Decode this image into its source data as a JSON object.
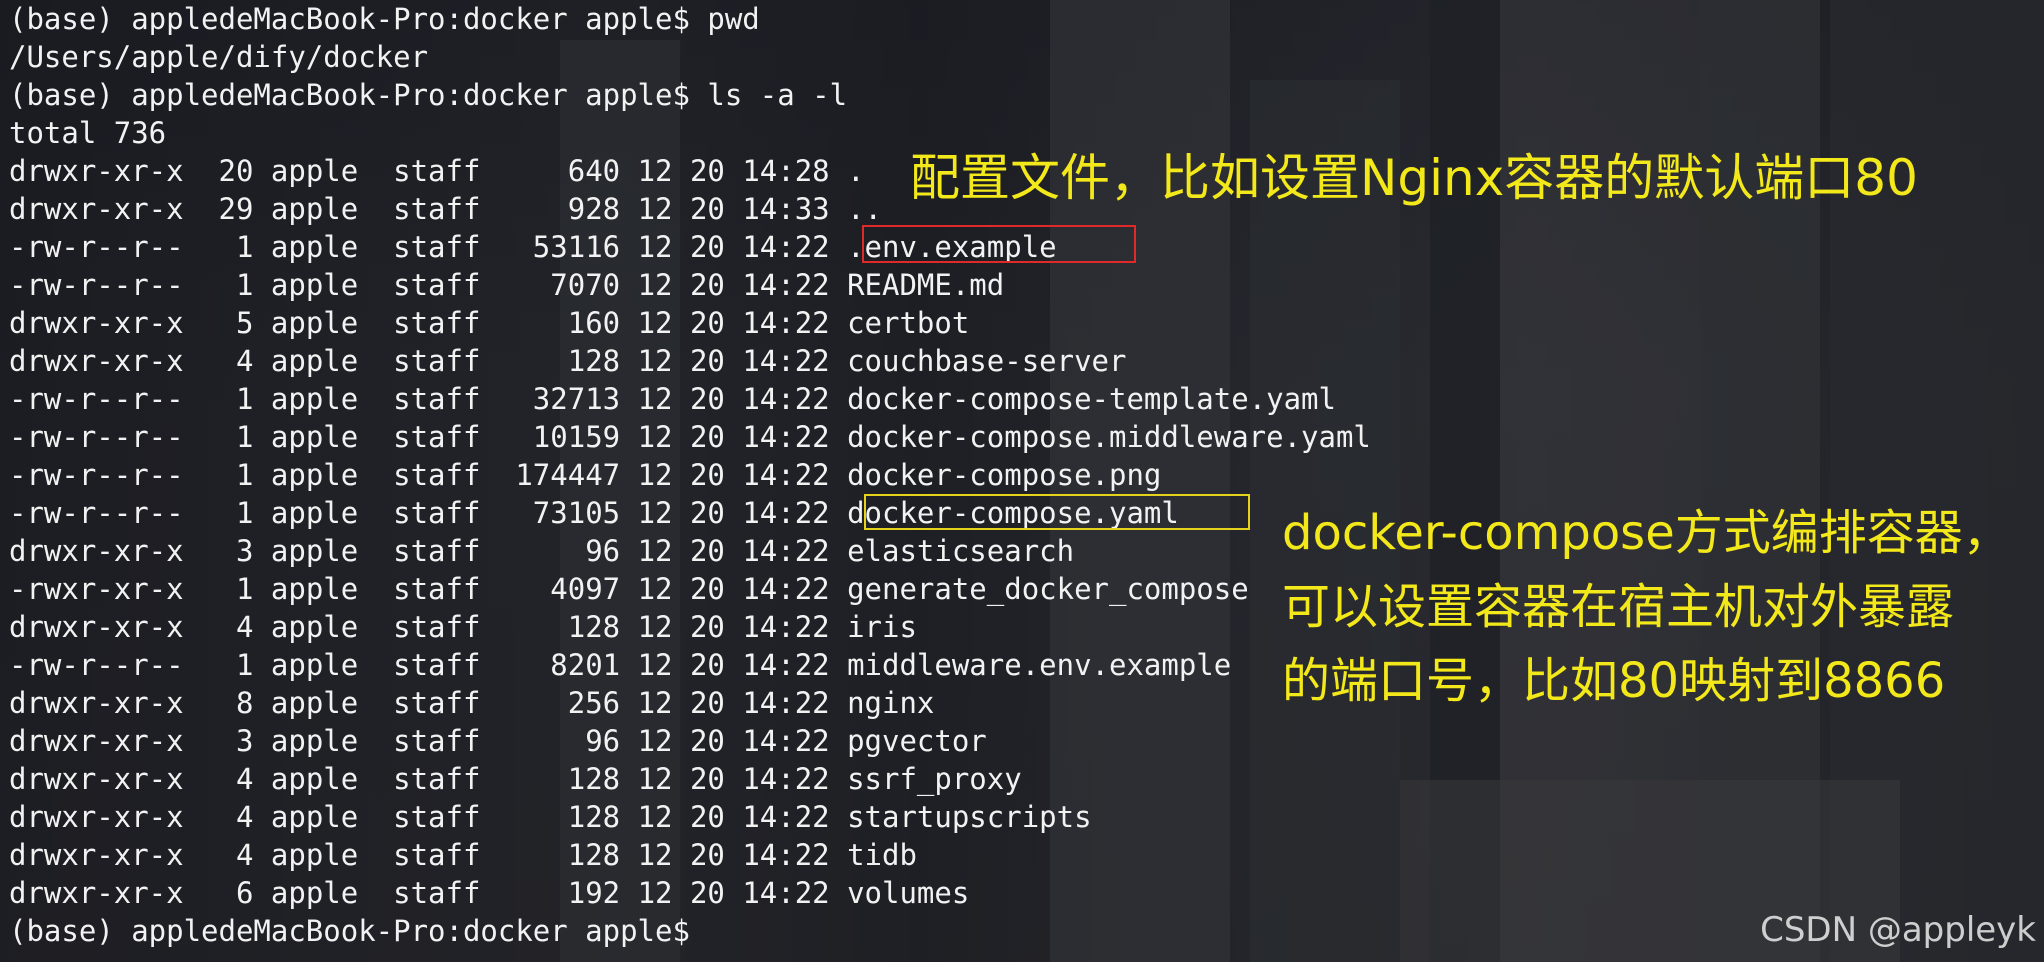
{
  "terminal": {
    "cmd1": "(base) appledeMacBook-Pro:docker apple$ pwd",
    "cmd1_output": "/Users/apple/dify/docker",
    "cmd2": "(base) appledeMacBook-Pro:docker apple$ ls -a -l",
    "total": "total 736",
    "prompt_final": "(base) appledeMacBook-Pro:docker apple$",
    "listing": [
      {
        "perm": "drwxr-xr-x",
        "links": "20",
        "owner": "apple",
        "group": "staff",
        "size": "640",
        "date": "12 20 14:28",
        "name": "."
      },
      {
        "perm": "drwxr-xr-x",
        "links": "29",
        "owner": "apple",
        "group": "staff",
        "size": "928",
        "date": "12 20 14:33",
        "name": ".."
      },
      {
        "perm": "-rw-r--r--",
        "links": "1",
        "owner": "apple",
        "group": "staff",
        "size": "53116",
        "date": "12 20 14:22",
        "name": ".env.example"
      },
      {
        "perm": "-rw-r--r--",
        "links": "1",
        "owner": "apple",
        "group": "staff",
        "size": "7070",
        "date": "12 20 14:22",
        "name": "README.md"
      },
      {
        "perm": "drwxr-xr-x",
        "links": "5",
        "owner": "apple",
        "group": "staff",
        "size": "160",
        "date": "12 20 14:22",
        "name": "certbot"
      },
      {
        "perm": "drwxr-xr-x",
        "links": "4",
        "owner": "apple",
        "group": "staff",
        "size": "128",
        "date": "12 20 14:22",
        "name": "couchbase-server"
      },
      {
        "perm": "-rw-r--r--",
        "links": "1",
        "owner": "apple",
        "group": "staff",
        "size": "32713",
        "date": "12 20 14:22",
        "name": "docker-compose-template.yaml"
      },
      {
        "perm": "-rw-r--r--",
        "links": "1",
        "owner": "apple",
        "group": "staff",
        "size": "10159",
        "date": "12 20 14:22",
        "name": "docker-compose.middleware.yaml"
      },
      {
        "perm": "-rw-r--r--",
        "links": "1",
        "owner": "apple",
        "group": "staff",
        "size": "174447",
        "date": "12 20 14:22",
        "name": "docker-compose.png"
      },
      {
        "perm": "-rw-r--r--",
        "links": "1",
        "owner": "apple",
        "group": "staff",
        "size": "73105",
        "date": "12 20 14:22",
        "name": "docker-compose.yaml"
      },
      {
        "perm": "drwxr-xr-x",
        "links": "3",
        "owner": "apple",
        "group": "staff",
        "size": "96",
        "date": "12 20 14:22",
        "name": "elasticsearch"
      },
      {
        "perm": "-rwxr-xr-x",
        "links": "1",
        "owner": "apple",
        "group": "staff",
        "size": "4097",
        "date": "12 20 14:22",
        "name": "generate_docker_compose"
      },
      {
        "perm": "drwxr-xr-x",
        "links": "4",
        "owner": "apple",
        "group": "staff",
        "size": "128",
        "date": "12 20 14:22",
        "name": "iris"
      },
      {
        "perm": "-rw-r--r--",
        "links": "1",
        "owner": "apple",
        "group": "staff",
        "size": "8201",
        "date": "12 20 14:22",
        "name": "middleware.env.example"
      },
      {
        "perm": "drwxr-xr-x",
        "links": "8",
        "owner": "apple",
        "group": "staff",
        "size": "256",
        "date": "12 20 14:22",
        "name": "nginx"
      },
      {
        "perm": "drwxr-xr-x",
        "links": "3",
        "owner": "apple",
        "group": "staff",
        "size": "96",
        "date": "12 20 14:22",
        "name": "pgvector"
      },
      {
        "perm": "drwxr-xr-x",
        "links": "4",
        "owner": "apple",
        "group": "staff",
        "size": "128",
        "date": "12 20 14:22",
        "name": "ssrf_proxy"
      },
      {
        "perm": "drwxr-xr-x",
        "links": "4",
        "owner": "apple",
        "group": "staff",
        "size": "128",
        "date": "12 20 14:22",
        "name": "startupscripts"
      },
      {
        "perm": "drwxr-xr-x",
        "links": "4",
        "owner": "apple",
        "group": "staff",
        "size": "128",
        "date": "12 20 14:22",
        "name": "tidb"
      },
      {
        "perm": "drwxr-xr-x",
        "links": "6",
        "owner": "apple",
        "group": "staff",
        "size": "192",
        "date": "12 20 14:22",
        "name": "volumes"
      }
    ]
  },
  "annotations": {
    "config_note": "配置文件，比如设置Nginx容器的默认端口80",
    "compose_note_line1": "docker-compose方式编排容器，",
    "compose_note_line2": "可以设置容器在宿主机对外暴露",
    "compose_note_line3": "的端口号，比如80映射到8866"
  },
  "watermark": "CSDN @appleyk",
  "colors": {
    "terminal_text": "#f2f2f2",
    "annotation_text": "#f3e81a",
    "env_box": "#e02a2a",
    "compose_box": "#e6d21a"
  }
}
